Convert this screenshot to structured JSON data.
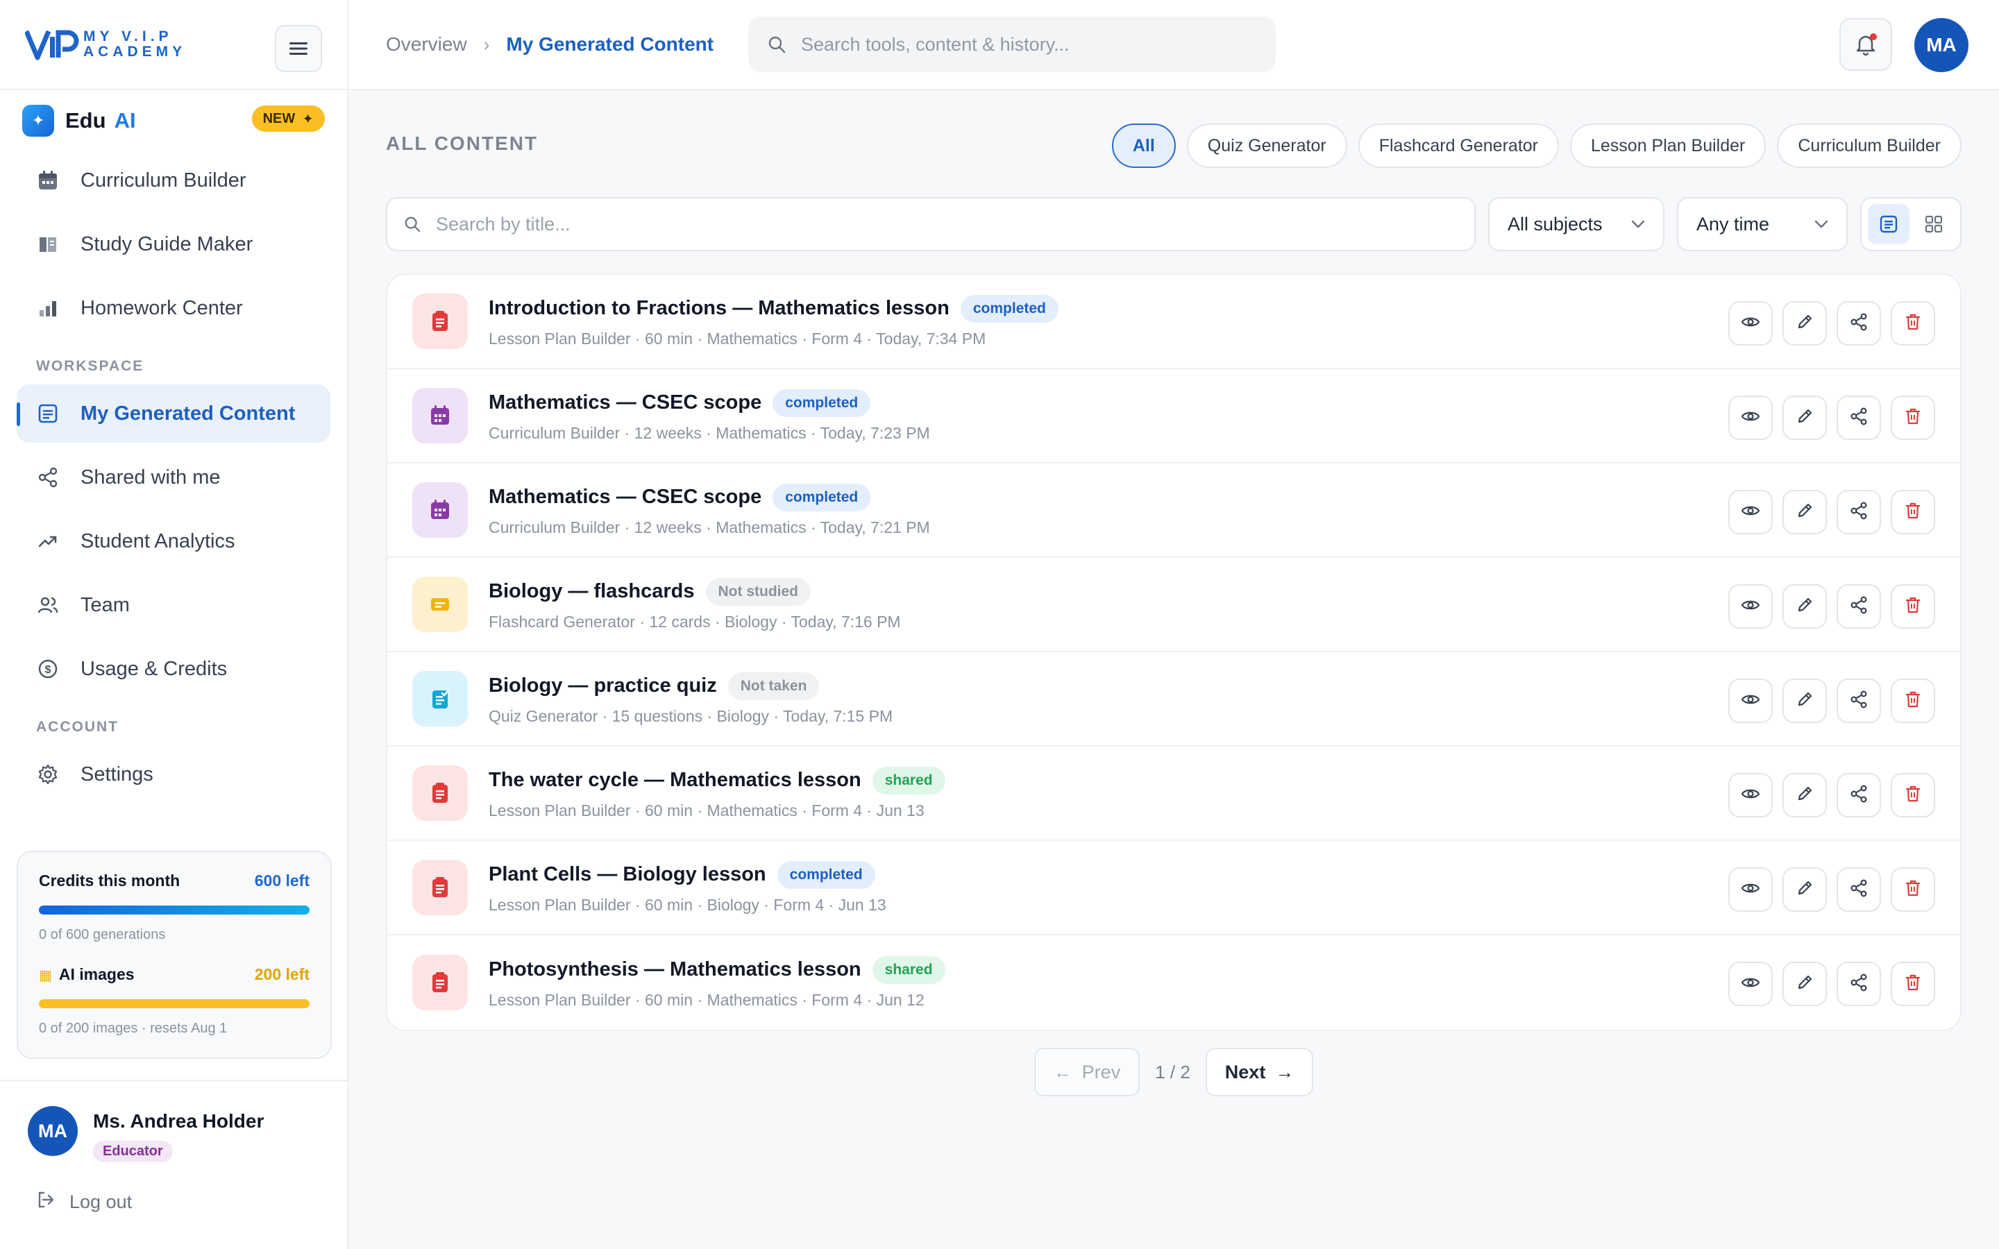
{
  "brand": {
    "logo_line1": "MY V.I.P",
    "logo_line2": "ACADEMY"
  },
  "eduai": {
    "name": "Edu",
    "ai": "AI",
    "badge": "NEW"
  },
  "nav_tools": [
    {
      "label": "Curriculum Builder",
      "icon": "calendar-icon"
    },
    {
      "label": "Study Guide Maker",
      "icon": "book-icon"
    },
    {
      "label": "Homework Center",
      "icon": "bar-chart-icon"
    }
  ],
  "sections": {
    "workspace": "WORKSPACE",
    "account": "ACCOUNT"
  },
  "nav_workspace": [
    {
      "label": "My Generated Content",
      "icon": "document-icon",
      "active": true
    },
    {
      "label": "Shared with me",
      "icon": "share-icon"
    },
    {
      "label": "Student Analytics",
      "icon": "trend-icon"
    },
    {
      "label": "Team",
      "icon": "users-icon"
    },
    {
      "label": "Usage & Credits",
      "icon": "coin-icon"
    }
  ],
  "nav_account": [
    {
      "label": "Settings",
      "icon": "gear-icon"
    }
  ],
  "credits": {
    "title": "Credits this month",
    "left": "600 left",
    "progress": 1.0,
    "sub": "0 of 600 generations",
    "images_title": "AI images",
    "images_left": "200 left",
    "images_progress": 1.0,
    "images_sub": "0 of 200 images · resets Aug 1",
    "colors": {
      "credits": "#1565d8",
      "images": "#f9bf25"
    }
  },
  "user": {
    "initials": "MA",
    "name": "Ms. Andrea Holder",
    "role": "Educator",
    "logout": "Log out"
  },
  "topbar": {
    "crumb_root": "Overview",
    "crumb_current": "My Generated Content",
    "search_placeholder": "Search tools, content & history...",
    "avatar": "MA"
  },
  "content": {
    "title": "ALL CONTENT",
    "filters": [
      "All",
      "Quiz Generator",
      "Flashcard Generator",
      "Lesson Plan Builder",
      "Curriculum Builder"
    ],
    "active_filter": "All",
    "title_search_placeholder": "Search by title...",
    "subjects": "All subjects",
    "time": "Any time"
  },
  "items": [
    {
      "title": "Introduction to Fractions — Mathematics lesson",
      "status": "completed",
      "status_type": "completed",
      "meta": "Lesson Plan Builder · 60 min · Mathematics · Form 4 · Today, 7:34 PM",
      "type": "lesson"
    },
    {
      "title": "Mathematics — CSEC scope",
      "status": "completed",
      "status_type": "completed",
      "meta": "Curriculum Builder · 12 weeks · Mathematics · Today, 7:23 PM",
      "type": "curriculum"
    },
    {
      "title": "Mathematics — CSEC scope",
      "status": "completed",
      "status_type": "completed",
      "meta": "Curriculum Builder · 12 weeks · Mathematics · Today, 7:21 PM",
      "type": "curriculum"
    },
    {
      "title": "Biology — flashcards",
      "status": "Not studied",
      "status_type": "muted",
      "meta": "Flashcard Generator · 12 cards · Biology · Today, 7:16 PM",
      "type": "flashcard"
    },
    {
      "title": "Biology — practice quiz",
      "status": "Not taken",
      "status_type": "muted",
      "meta": "Quiz Generator · 15 questions · Biology · Today, 7:15 PM",
      "type": "quiz"
    },
    {
      "title": "The water cycle — Mathematics lesson",
      "status": "shared",
      "status_type": "shared",
      "meta": "Lesson Plan Builder · 60 min · Mathematics · Form 4 · Jun 13",
      "type": "lesson"
    },
    {
      "title": "Plant Cells — Biology lesson",
      "status": "completed",
      "status_type": "completed",
      "meta": "Lesson Plan Builder · 60 min · Biology · Form 4 · Jun 13",
      "type": "lesson"
    },
    {
      "title": "Photosynthesis — Mathematics lesson",
      "status": "shared",
      "status_type": "shared",
      "meta": "Lesson Plan Builder · 60 min · Mathematics · Form 4 · Jun 12",
      "type": "lesson"
    }
  ],
  "pager": {
    "prev": "Prev",
    "page": "1 / 2",
    "next": "Next"
  },
  "type_colors": {
    "lesson": {
      "bg": "#fde4e4",
      "fg": "#e03a3a"
    },
    "curriculum": {
      "bg": "#efe2f6",
      "fg": "#8a3aa8"
    },
    "flashcard": {
      "bg": "#fdf0cc",
      "fg": "#f2b40b"
    },
    "quiz": {
      "bg": "#d9f3fb",
      "fg": "#12a7d4"
    }
  }
}
